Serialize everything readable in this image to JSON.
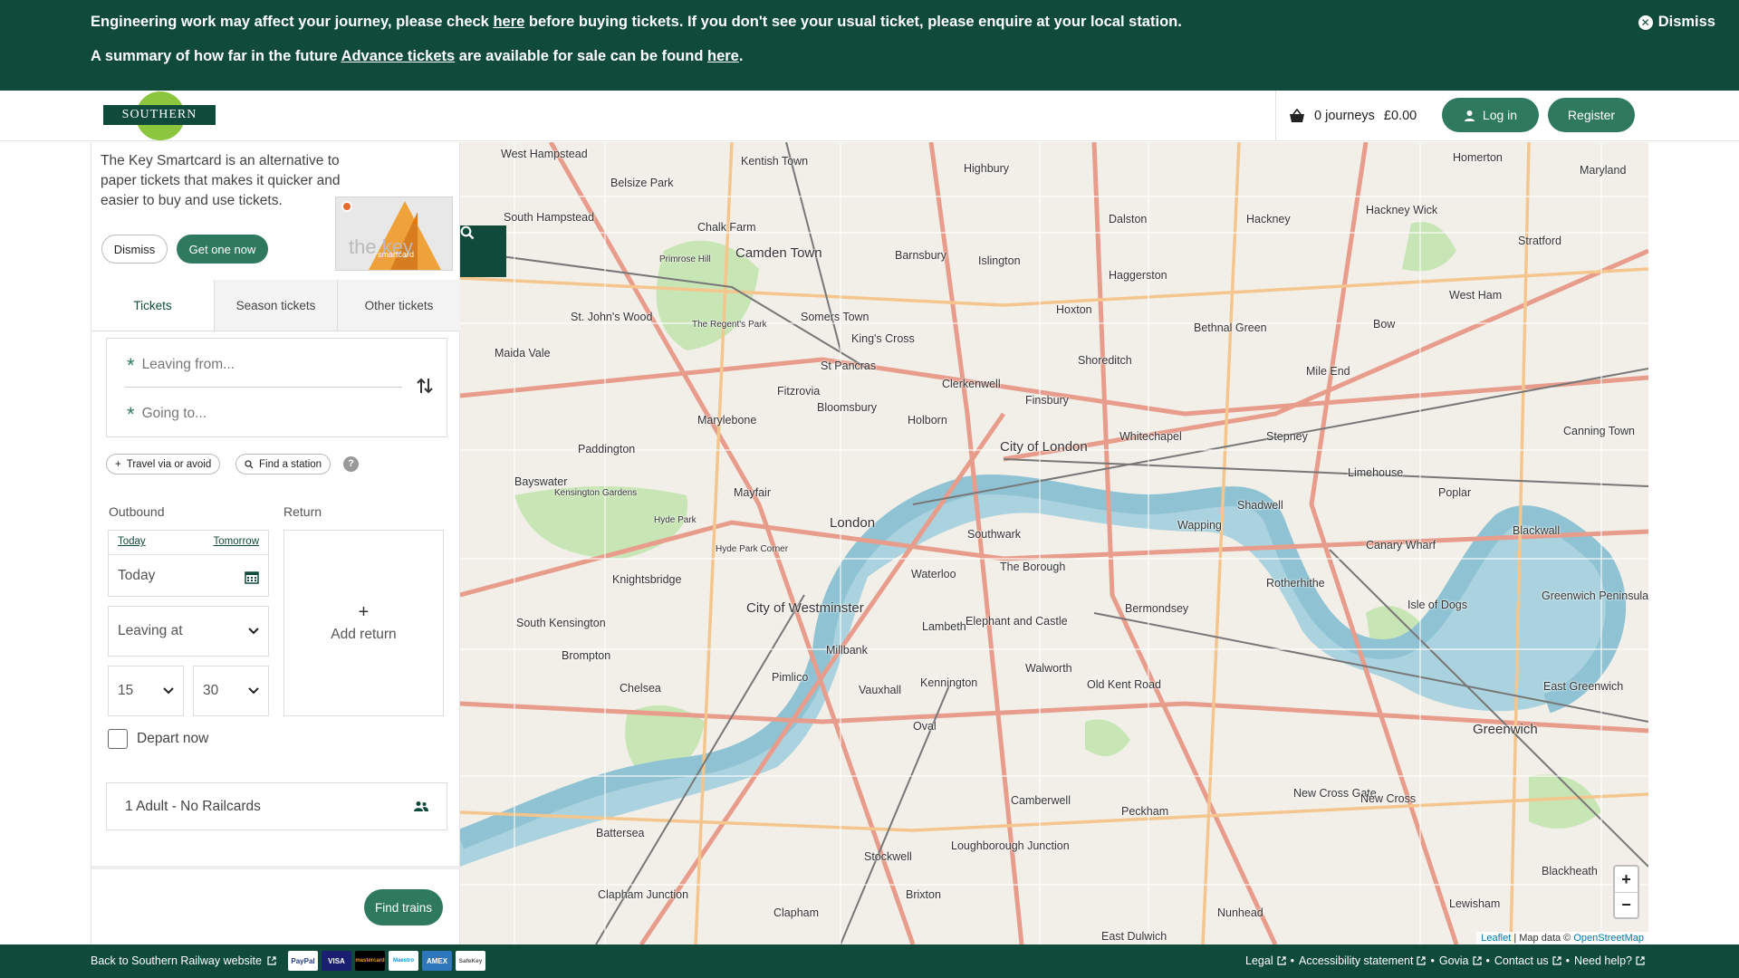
{
  "banner": {
    "line1_pre": "Engineering work may affect your journey, please check ",
    "line1_link": "here",
    "line1_post": " before buying tickets. If you don't see your usual ticket, please enquire at your local station.",
    "line2_pre": "A summary of how far in the future ",
    "line2_link1": "Advance tickets",
    "line2_mid": " are available for sale can be found ",
    "line2_link2": "here",
    "line2_post": ".",
    "dismiss_label": "Dismiss"
  },
  "header": {
    "logo_text": "SOUTHERN",
    "basket_journeys": "0 journeys",
    "basket_total": "£0.00",
    "login_label": "Log in",
    "register_label": "Register"
  },
  "promo": {
    "text": "The Key Smartcard is an alternative to paper tickets that makes it quicker and easier to buy and use tickets.",
    "dismiss_label": "Dismiss",
    "cta_label": "Get one now",
    "card_brand": "the key",
    "card_sub": "smartcard"
  },
  "tabs": [
    {
      "label": "Tickets"
    },
    {
      "label": "Season tickets"
    },
    {
      "label": "Other tickets"
    }
  ],
  "search": {
    "from_placeholder": "Leaving from...",
    "to_placeholder": "Going to...",
    "via_label": "Travel via or avoid",
    "find_station_label": "Find a station",
    "help_label": "?"
  },
  "outbound": {
    "label": "Outbound",
    "today_link": "Today",
    "tomorrow_link": "Tomorrow",
    "date_value": "Today",
    "time_mode": "Leaving at",
    "hour": "15",
    "minute": "30",
    "depart_now_label": "Depart now"
  },
  "return": {
    "label": "Return",
    "plus": "+",
    "add_label": "Add return"
  },
  "passengers": {
    "label": "1 Adult - No Railcards"
  },
  "find_trains_label": "Find trains",
  "map": {
    "labels": [
      {
        "text": "West Hampstead"
      },
      {
        "text": "Kentish Town"
      },
      {
        "text": "Homerton"
      },
      {
        "text": "Maryland"
      },
      {
        "text": "Belsize Park"
      },
      {
        "text": "Highbury"
      },
      {
        "text": "Hackney Wick"
      },
      {
        "text": "South Hampstead"
      },
      {
        "text": "Dalston"
      },
      {
        "text": "Hackney"
      },
      {
        "text": "Stratford"
      },
      {
        "text": "Chalk Farm"
      },
      {
        "text": "Camden Town"
      },
      {
        "text": "Barnsbury"
      },
      {
        "text": "Islington"
      },
      {
        "text": "Haggerston"
      },
      {
        "text": "Primrose Hill"
      },
      {
        "text": "St. John's Wood"
      },
      {
        "text": "Somers Town"
      },
      {
        "text": "Hoxton"
      },
      {
        "text": "Bethnal Green"
      },
      {
        "text": "Bow"
      },
      {
        "text": "West Ham"
      },
      {
        "text": "King's Cross"
      },
      {
        "text": "Maida Vale"
      },
      {
        "text": "The Regent's Park"
      },
      {
        "text": "St Pancras"
      },
      {
        "text": "Shoreditch"
      },
      {
        "text": "Mile End"
      },
      {
        "text": "Clerkenwell"
      },
      {
        "text": "Fitzrovia"
      },
      {
        "text": "Finsbury"
      },
      {
        "text": "Marylebone"
      },
      {
        "text": "Bloomsbury"
      },
      {
        "text": "Holborn"
      },
      {
        "text": "Canning Town"
      },
      {
        "text": "Paddington"
      },
      {
        "text": "City of London"
      },
      {
        "text": "Whitechapel"
      },
      {
        "text": "Stepney"
      },
      {
        "text": "Limehouse"
      },
      {
        "text": "Bayswater"
      },
      {
        "text": "Mayfair"
      },
      {
        "text": "Poplar"
      },
      {
        "text": "Shadwell"
      },
      {
        "text": "Wapping"
      },
      {
        "text": "London"
      },
      {
        "text": "Blackwall"
      },
      {
        "text": "Kensington Gardens"
      },
      {
        "text": "Hyde Park"
      },
      {
        "text": "Southwark"
      },
      {
        "text": "Canary Wharf"
      },
      {
        "text": "Knightsbridge"
      },
      {
        "text": "Hyde Park Corner"
      },
      {
        "text": "Waterloo"
      },
      {
        "text": "The Borough"
      },
      {
        "text": "Rotherhithe"
      },
      {
        "text": "Greenwich Peninsula"
      },
      {
        "text": "City of Westminster"
      },
      {
        "text": "Bermondsey"
      },
      {
        "text": "Isle of Dogs"
      },
      {
        "text": "South Kensington"
      },
      {
        "text": "Lambeth"
      },
      {
        "text": "Elephant and Castle"
      },
      {
        "text": "Brompton"
      },
      {
        "text": "Millbank"
      },
      {
        "text": "Walworth"
      },
      {
        "text": "Pimlico"
      },
      {
        "text": "Chelsea"
      },
      {
        "text": "Vauxhall"
      },
      {
        "text": "Kennington"
      },
      {
        "text": "Old Kent Road"
      },
      {
        "text": "East Greenwich"
      },
      {
        "text": "Oval"
      },
      {
        "text": "Greenwich"
      },
      {
        "text": "Camberwell"
      },
      {
        "text": "Peckham"
      },
      {
        "text": "New Cross Gate"
      },
      {
        "text": "New Cross"
      },
      {
        "text": "Battersea"
      },
      {
        "text": "Stockwell"
      },
      {
        "text": "Loughborough Junction"
      },
      {
        "text": "Blackheath"
      },
      {
        "text": "Clapham Junction"
      },
      {
        "text": "Brixton"
      },
      {
        "text": "Lewisham"
      },
      {
        "text": "Clapham"
      },
      {
        "text": "Nunhead"
      },
      {
        "text": "East Dulwich"
      }
    ],
    "attribution_leaflet": "Leaflet",
    "attribution_mid": " | Map data © ",
    "attribution_osm": "OpenStreetMap",
    "zoom_in": "+",
    "zoom_out": "−"
  },
  "footer": {
    "back_label": "Back to Southern Railway website",
    "payments": [
      "PayPal",
      "VISA",
      "mastercard",
      "Maestro",
      "AMEX",
      "SafeKey"
    ],
    "links": [
      "Legal",
      "Accessibility statement",
      "Govia",
      "Contact us",
      "Need help?"
    ],
    "separator": "•"
  },
  "colors": {
    "brand_dark": "#0f4a3b",
    "brand_button": "#2f7a5e",
    "logo_green": "#8cc63e"
  }
}
